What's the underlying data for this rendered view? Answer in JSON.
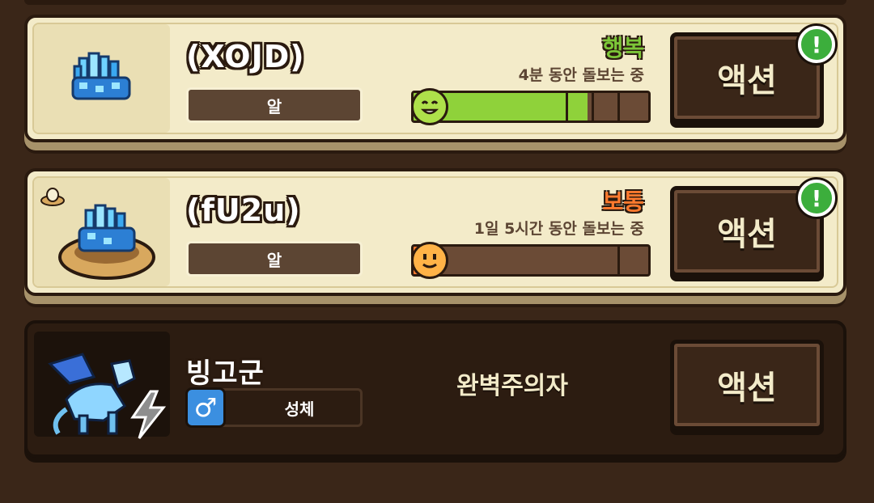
{
  "pets": [
    {
      "name": "(XOJD)",
      "stage": "알",
      "mood": "행복",
      "mood_color": "#7cc638",
      "care_time": "4분 동안 돌보는 중",
      "progress": 0.74,
      "bar_color": "#8fd23a",
      "face": "happy",
      "action": "액션",
      "alert": "!"
    },
    {
      "name": "(fU2u)",
      "stage": "알",
      "mood": "보통",
      "mood_color": "#ff7a2e",
      "care_time": "1일 5시간 동안 돌보는 중",
      "progress": 0.07,
      "bar_color": "#ff7a2e",
      "face": "neutral",
      "action": "액션",
      "alert": "!"
    },
    {
      "name": "빙고군",
      "gender_icon": "♂",
      "stage": "성체",
      "trait": "완벽주의자",
      "action": "액션",
      "element": "lightning-icon"
    }
  ]
}
